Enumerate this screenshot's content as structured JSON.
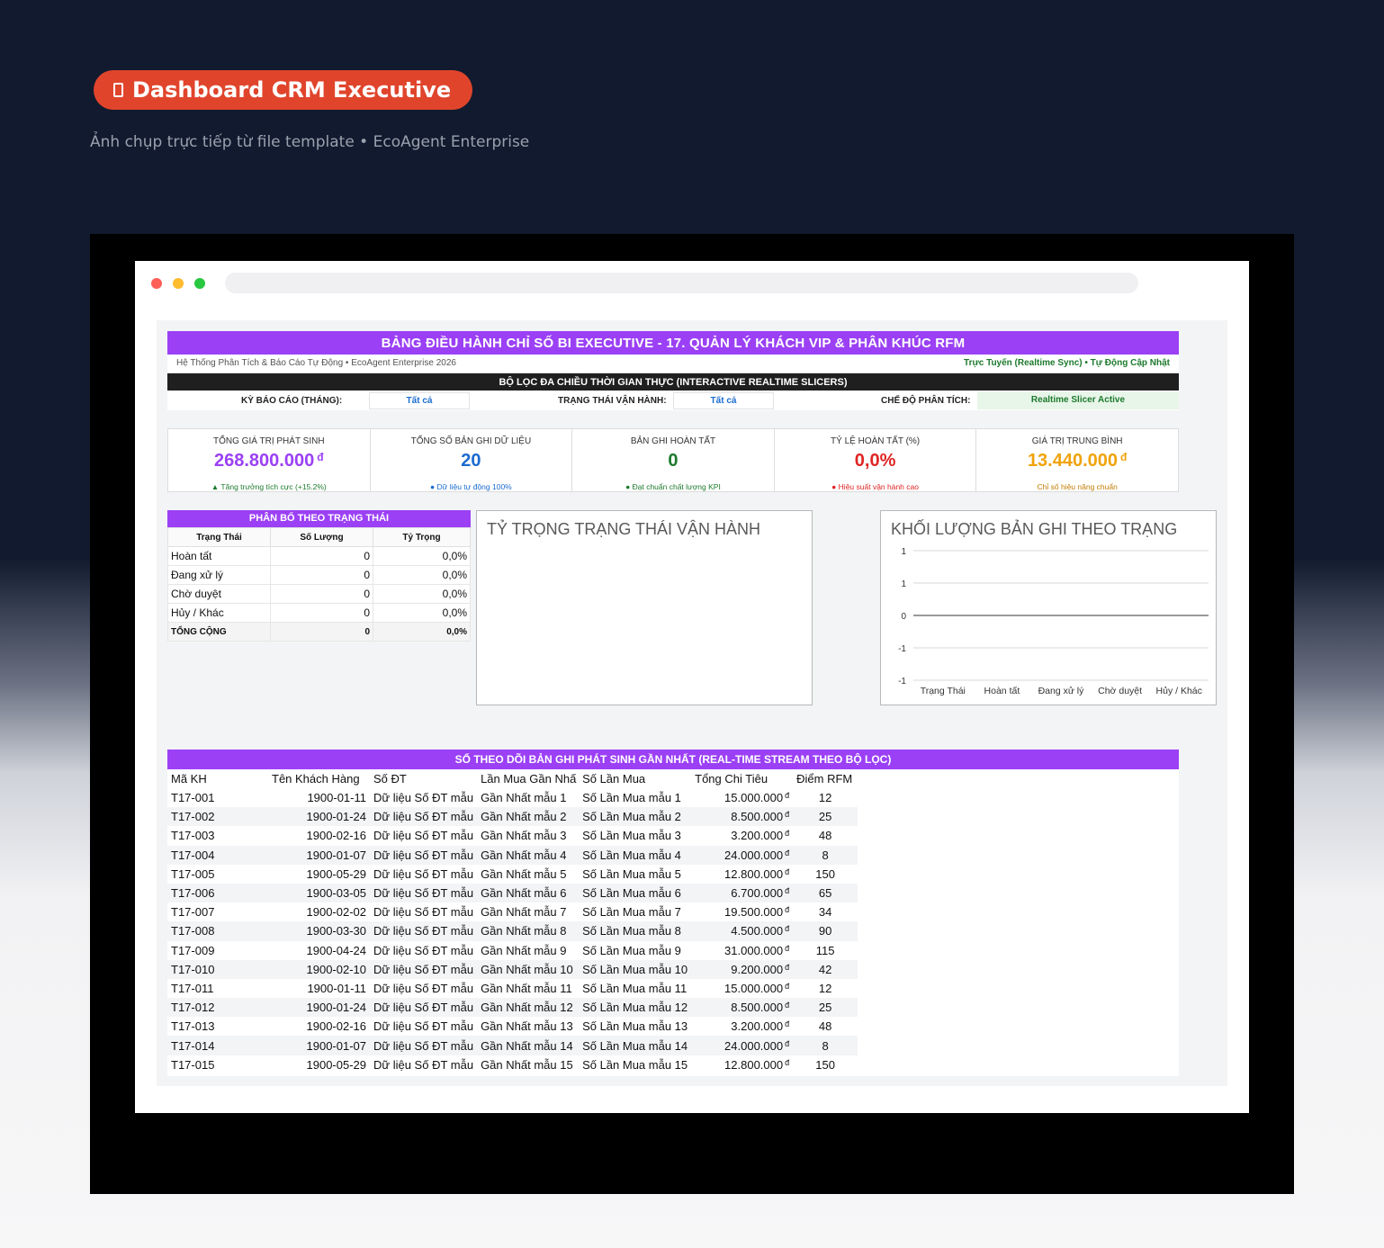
{
  "page": {
    "badge_label": "Dashboard CRM Executive",
    "subtitle": "Ảnh chụp trực tiếp từ file template • EcoAgent Enterprise"
  },
  "colors": {
    "accent": "#9b40f5",
    "badge": "#e0452c",
    "green": "#1c7a2c"
  },
  "header": {
    "title": "BẢNG ĐIỀU HÀNH CHỈ SỐ BI EXECUTIVE - 17. QUẢN LÝ KHÁCH VIP & PHÂN KHÚC RFM",
    "system": "Hệ Thống Phân Tích & Báo Cáo Tự Động • EcoAgent Enterprise 2026",
    "sync": "Trực Tuyến (Realtime Sync) • Tự Động Cập Nhật"
  },
  "filters": {
    "title": "BỘ LỌC ĐA CHIỀU THỜI GIAN THỰC (INTERACTIVE REALTIME SLICERS)",
    "period_label": "KỲ BÁO CÁO (THÁNG):",
    "period_value": "Tất cả",
    "status_label": "TRẠNG THÁI VẬN HÀNH:",
    "status_value": "Tất cả",
    "mode_label": "CHẾ ĐỘ PHÂN TÍCH:",
    "mode_value": "Realtime Slicer Active"
  },
  "kpis": [
    {
      "title": "TỔNG GIÁ TRỊ PHÁT SINH",
      "value": "268.800.000",
      "currency": "đ",
      "note": "▲ Tăng trưởng tích cực (+15.2%)",
      "color": "#9b40f5",
      "note_color": "#1c7a2c"
    },
    {
      "title": "TỔNG SỐ BẢN GHI DỮ LIỆU",
      "value": "20",
      "currency": "",
      "note": "● Dữ liệu tự động 100%",
      "color": "#1a6ccf",
      "note_color": "#1a6ccf"
    },
    {
      "title": "BẢN GHI HOÀN TẤT",
      "value": "0",
      "currency": "",
      "note": "● Đạt chuẩn chất lượng KPI",
      "color": "#1c7a2c",
      "note_color": "#1c7a2c"
    },
    {
      "title": "TỶ LỆ HOÀN TẤT (%)",
      "value": "0,0%",
      "currency": "",
      "note": "● Hiệu suất vận hành cao",
      "color": "#e02424",
      "note_color": "#e02424"
    },
    {
      "title": "GIÁ TRỊ TRUNG BÌNH",
      "value": "13.440.000",
      "currency": "đ",
      "note": "Chỉ số hiệu năng chuẩn",
      "color": "#f0a30a",
      "note_color": "#c27c00"
    }
  ],
  "distribution": {
    "title": "PHÂN BỔ THEO TRẠNG THÁI",
    "columns": [
      "Trạng Thái",
      "Số Lượng",
      "Tỷ Trọng"
    ],
    "rows": [
      [
        "Hoàn tất",
        "0",
        "0,0%"
      ],
      [
        "Đang xử lý",
        "0",
        "0,0%"
      ],
      [
        "Chờ duyệt",
        "0",
        "0,0%"
      ],
      [
        "Hủy / Khác",
        "0",
        "0,0%"
      ]
    ],
    "total": [
      "TỔNG CỘNG",
      "0",
      "0,0%"
    ]
  },
  "pie_chart": {
    "title": "TỶ TRỌNG TRẠNG THÁI VẬN HÀNH"
  },
  "chart_data": {
    "type": "bar",
    "title": "KHỐI LƯỢNG BẢN GHI THEO TRẠNG",
    "categories": [
      "Trạng Thái",
      "Hoàn tất",
      "Đang xử lý",
      "Chờ duyệt",
      "Hủy / Khác"
    ],
    "values": [
      0,
      0,
      0,
      0,
      0
    ],
    "yticks": [
      1,
      0.5,
      0,
      -0.5,
      -1
    ],
    "ytick_labels": [
      "1",
      "1",
      "0",
      "-1",
      "-1"
    ],
    "ylim": [
      -1,
      1
    ],
    "grid": true
  },
  "log": {
    "title": "SỔ THEO DÕI BẢN GHI PHÁT SINH GẦN NHẤT (REAL-TIME STREAM THEO BỘ LỌC)",
    "columns": [
      "Mã KH",
      "Tên Khách Hàng",
      "Số ĐT",
      "Lần Mua Gần Nhấ",
      "Số Lần Mua",
      "Tổng Chi Tiêu",
      "Điểm RFM"
    ],
    "currency": "đ",
    "rows": [
      [
        "T17-001",
        "1900-01-11",
        "Dữ liệu Số ĐT mẫu",
        "Gần Nhất mẫu 1",
        "Số Lần Mua mẫu 1",
        "15.000.000",
        "12"
      ],
      [
        "T17-002",
        "1900-01-24",
        "Dữ liệu Số ĐT mẫu",
        "Gần Nhất mẫu 2",
        "Số Lần Mua mẫu 2",
        "8.500.000",
        "25"
      ],
      [
        "T17-003",
        "1900-02-16",
        "Dữ liệu Số ĐT mẫu",
        "Gần Nhất mẫu 3",
        "Số Lần Mua mẫu 3",
        "3.200.000",
        "48"
      ],
      [
        "T17-004",
        "1900-01-07",
        "Dữ liệu Số ĐT mẫu",
        "Gần Nhất mẫu 4",
        "Số Lần Mua mẫu 4",
        "24.000.000",
        "8"
      ],
      [
        "T17-005",
        "1900-05-29",
        "Dữ liệu Số ĐT mẫu",
        "Gần Nhất mẫu 5",
        "Số Lần Mua mẫu 5",
        "12.800.000",
        "150"
      ],
      [
        "T17-006",
        "1900-03-05",
        "Dữ liệu Số ĐT mẫu",
        "Gần Nhất mẫu 6",
        "Số Lần Mua mẫu 6",
        "6.700.000",
        "65"
      ],
      [
        "T17-007",
        "1900-02-02",
        "Dữ liệu Số ĐT mẫu",
        "Gần Nhất mẫu 7",
        "Số Lần Mua mẫu 7",
        "19.500.000",
        "34"
      ],
      [
        "T17-008",
        "1900-03-30",
        "Dữ liệu Số ĐT mẫu",
        "Gần Nhất mẫu 8",
        "Số Lần Mua mẫu 8",
        "4.500.000",
        "90"
      ],
      [
        "T17-009",
        "1900-04-24",
        "Dữ liệu Số ĐT mẫu",
        "Gần Nhất mẫu 9",
        "Số Lần Mua mẫu 9",
        "31.000.000",
        "115"
      ],
      [
        "T17-010",
        "1900-02-10",
        "Dữ liệu Số ĐT mẫu",
        "Gần Nhất mẫu 10",
        "Số Lần Mua mẫu 10",
        "9.200.000",
        "42"
      ],
      [
        "T17-011",
        "1900-01-11",
        "Dữ liệu Số ĐT mẫu",
        "Gần Nhất mẫu 11",
        "Số Lần Mua mẫu 11",
        "15.000.000",
        "12"
      ],
      [
        "T17-012",
        "1900-01-24",
        "Dữ liệu Số ĐT mẫu",
        "Gần Nhất mẫu 12",
        "Số Lần Mua mẫu 12",
        "8.500.000",
        "25"
      ],
      [
        "T17-013",
        "1900-02-16",
        "Dữ liệu Số ĐT mẫu",
        "Gần Nhất mẫu 13",
        "Số Lần Mua mẫu 13",
        "3.200.000",
        "48"
      ],
      [
        "T17-014",
        "1900-01-07",
        "Dữ liệu Số ĐT mẫu",
        "Gần Nhất mẫu 14",
        "Số Lần Mua mẫu 14",
        "24.000.000",
        "8"
      ],
      [
        "T17-015",
        "1900-05-29",
        "Dữ liệu Số ĐT mẫu",
        "Gần Nhất mẫu 15",
        "Số Lần Mua mẫu 15",
        "12.800.000",
        "150"
      ]
    ]
  }
}
